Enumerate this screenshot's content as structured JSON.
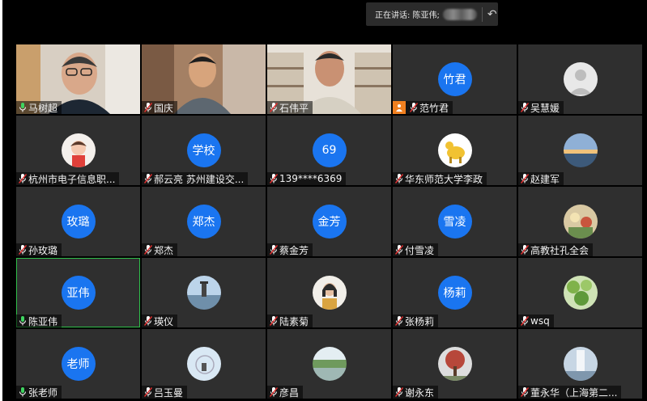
{
  "speaker": {
    "label": "正在讲话: 陈亚伟;"
  },
  "participants": [
    {
      "name": "马树超",
      "type": "video",
      "mic": "on"
    },
    {
      "name": "国庆",
      "type": "video",
      "mic": "muted"
    },
    {
      "name": "石伟平",
      "type": "video",
      "mic": "muted"
    },
    {
      "name": "范竹君",
      "type": "initials",
      "avatar_text": "竹君",
      "mic": "muted",
      "cam_off": true
    },
    {
      "name": "吴慧媛",
      "type": "photo",
      "photo": "default-person",
      "mic": "muted"
    },
    {
      "name": "杭州市电子信息职...",
      "type": "photo",
      "photo": "child",
      "mic": "muted"
    },
    {
      "name": "郝云亮 苏州建设交...",
      "type": "initials",
      "avatar_text": "学校",
      "mic": "muted"
    },
    {
      "name": "139****6369",
      "type": "initials",
      "avatar_text": "69",
      "mic": "muted"
    },
    {
      "name": "华东师范大学李政",
      "type": "photo",
      "photo": "horse",
      "mic": "muted"
    },
    {
      "name": "赵建军",
      "type": "photo",
      "photo": "sunset",
      "mic": "muted"
    },
    {
      "name": "孙玫璐",
      "type": "initials",
      "avatar_text": "玫璐",
      "mic": "muted"
    },
    {
      "name": "郑杰",
      "type": "initials",
      "avatar_text": "郑杰",
      "mic": "muted"
    },
    {
      "name": "蔡金芳",
      "type": "initials",
      "avatar_text": "金芳",
      "mic": "muted"
    },
    {
      "name": "付雪凌",
      "type": "initials",
      "avatar_text": "雪凌",
      "mic": "muted"
    },
    {
      "name": "高教社孔全会",
      "type": "photo",
      "photo": "flowers",
      "mic": "muted"
    },
    {
      "name": "陈亚伟",
      "type": "initials",
      "avatar_text": "亚伟",
      "mic": "on",
      "active": true
    },
    {
      "name": "瑛仪",
      "type": "photo",
      "photo": "lighthouse",
      "mic": "muted"
    },
    {
      "name": "陆素菊",
      "type": "photo",
      "photo": "woman",
      "mic": "muted"
    },
    {
      "name": "张杨莉",
      "type": "initials",
      "avatar_text": "杨莉",
      "mic": "muted"
    },
    {
      "name": "wsq",
      "type": "photo",
      "photo": "leaves",
      "mic": "muted"
    },
    {
      "name": "张老师",
      "type": "initials",
      "avatar_text": "老师",
      "mic": "on"
    },
    {
      "name": "吕玉曼",
      "type": "photo",
      "photo": "swing",
      "mic": "muted"
    },
    {
      "name": "彦昌",
      "type": "photo",
      "photo": "lake",
      "mic": "muted"
    },
    {
      "name": "谢永东",
      "type": "photo",
      "photo": "tree",
      "mic": "muted"
    },
    {
      "name": "董永华（上海第二...",
      "type": "photo",
      "photo": "waterfall",
      "mic": "muted"
    }
  ],
  "colors": {
    "tile_bg": "#2f2f2f",
    "avatar_blue": "#1a75f0",
    "active_border": "#2fbf4a",
    "cam_off": "#f08020"
  }
}
